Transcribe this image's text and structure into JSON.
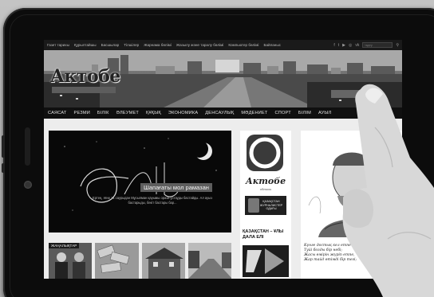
{
  "site": {
    "topbar_links": [
      "Газет тарихы",
      "Құрылтайшы",
      "Басшылар",
      "Тілшілер",
      "Жарнама бөлімі",
      "Жазылу және таралу бөлімі",
      "Компьютер бөлімі",
      "Байланыс"
    ],
    "search_placeholder": "Іздеу",
    "logo_text": "Актобе",
    "nav_items": [
      "САЯСАТ",
      "РЕЗМИ",
      "БІЛІК",
      "ӘЛЕУМЕТ",
      "ҚҰҚЫҚ",
      "ЭКОНОМИКА",
      "ДЕНСАУЛЫҚ",
      "МӘДЕНИЕТ",
      "СПОРТ",
      "БІЛІМ",
      "АУЫЛ"
    ]
  },
  "slider": {
    "caption": "Шапағаты мол рамазан",
    "text": "Ертең, яғни 14 саурыдан Мұсылман қауымы ораза ұстауды бастайды. Ал ауыз бастарыды, бекіт бастары бар..."
  },
  "news_strip": {
    "tag": "ЖАҢАЛЫҚТАР"
  },
  "sidebar": {
    "brand_name": "Актобе",
    "brand_sub": "облысы",
    "union_text": "ҚАЗАҚСТАН ЖУРНАЛИСТЕР ОДАҒЫ",
    "section_title": "ҚАЗАҚСТАН – ҰЛЫ ДАЛА ЕЛІ",
    "quote": "Күнге достық кел етпе –\nТуйі бозды бір небі;\nЖасы өмірін жүріп етпе,\nЖар тайд өтімді бір тегі;"
  },
  "colors": {
    "tablet_body": "#0c0c0c",
    "nav_bg": "#101010",
    "topbar_bg": "#1a1a1a",
    "screen_bg": "#e9e9e9"
  },
  "icons": [
    "search-icon",
    "facebook-icon",
    "twitter-icon",
    "youtube-icon",
    "instagram-icon",
    "vk-icon"
  ]
}
